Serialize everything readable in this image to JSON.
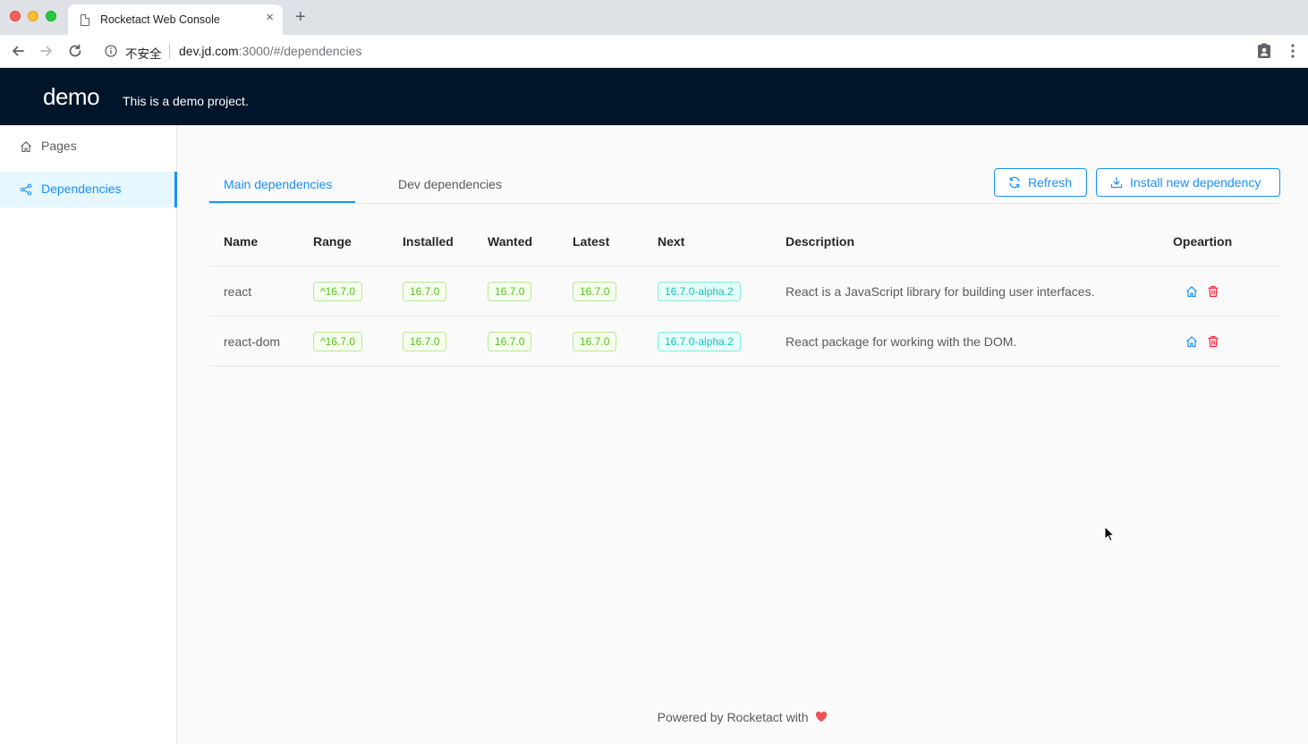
{
  "browser": {
    "tab_title": "Rocketact Web Console",
    "tab_close": "×",
    "new_tab": "+",
    "security_label": "不安全",
    "url_host": "dev.jd.com",
    "url_path": ":3000/#/dependencies"
  },
  "header": {
    "brand": "demo",
    "description": "This is a demo project."
  },
  "sidebar": {
    "items": [
      {
        "label": "Pages",
        "icon": "home-icon"
      },
      {
        "label": "Dependencies",
        "icon": "share-icon",
        "selected": true
      }
    ]
  },
  "tabs": [
    {
      "label": "Main dependencies",
      "active": true
    },
    {
      "label": "Dev dependencies",
      "active": false
    }
  ],
  "actions": {
    "refresh": "Refresh",
    "install": "Install new dependency"
  },
  "table": {
    "headers": {
      "name": "Name",
      "range": "Range",
      "installed": "Installed",
      "wanted": "Wanted",
      "latest": "Latest",
      "next": "Next",
      "description": "Description",
      "operation": "Opeartion"
    },
    "rows": [
      {
        "name": "react",
        "range": "^16.7.0",
        "installed": "16.7.0",
        "wanted": "16.7.0",
        "latest": "16.7.0",
        "next": "16.7.0-alpha.2",
        "description": "React is a JavaScript library for building user interfaces."
      },
      {
        "name": "react-dom",
        "range": "^16.7.0",
        "installed": "16.7.0",
        "wanted": "16.7.0",
        "latest": "16.7.0",
        "next": "16.7.0-alpha.2",
        "description": "React package for working with the DOM."
      }
    ]
  },
  "footer": {
    "text": "Powered by Rocketact with"
  },
  "colors": {
    "primary": "#1890ff",
    "header_bg": "#001529",
    "tag_green": "#52c41a",
    "tag_cyan": "#13c2c2",
    "danger": "#f5222d",
    "heart": "#ef5350"
  }
}
